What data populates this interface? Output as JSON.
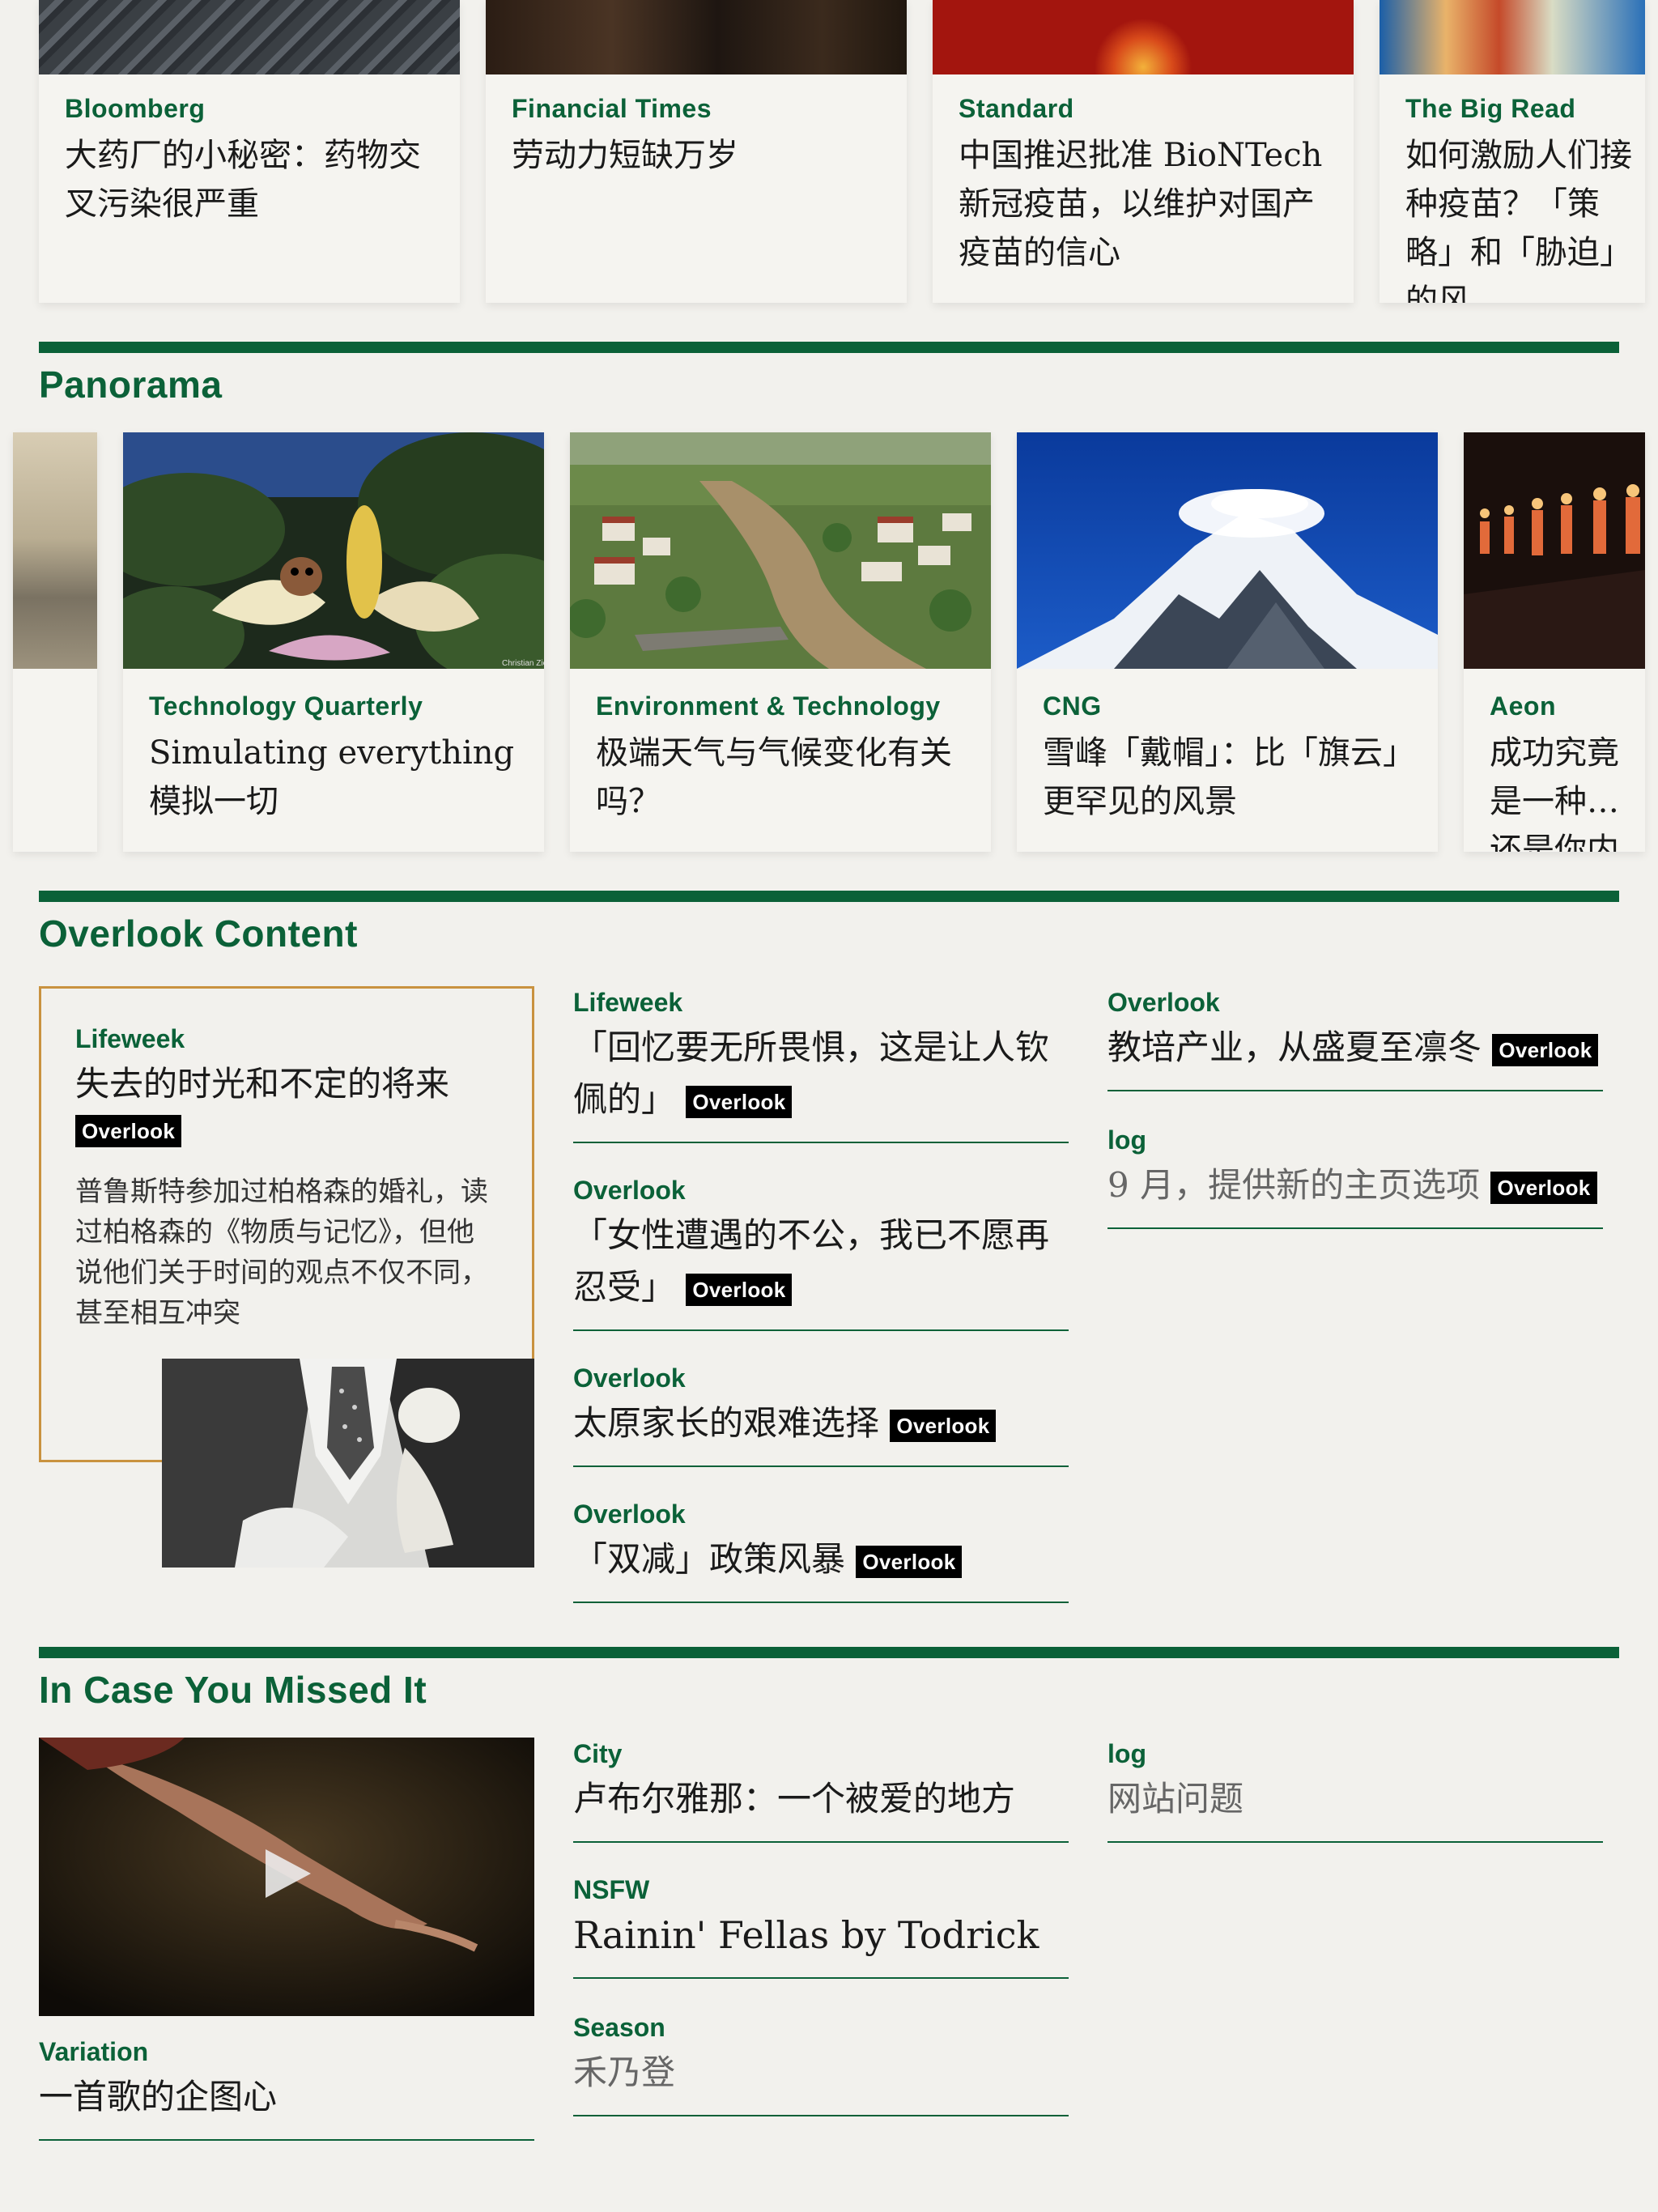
{
  "top_cards": [
    {
      "source": "Bloomberg",
      "title": "大药厂的小秘密：药物交叉污染很严重"
    },
    {
      "source": "Financial Times",
      "title": "劳动力短缺万岁"
    },
    {
      "source": "Standard",
      "title": "中国推迟批准 BioNTech 新冠疫苗，以维护对国产疫苗的信心"
    },
    {
      "source": "The Big Read",
      "title": "如何激励人们接种疫苗？「策略」和「胁迫」的风"
    }
  ],
  "panorama": {
    "heading": "Panorama",
    "cards": [
      {
        "source": "Technology Quarterly",
        "title": "Simulating everything 模拟一切",
        "photo_credit": "Christian Ziegler"
      },
      {
        "source": "Environment & Technology",
        "title": "极端天气与气候变化有关吗？"
      },
      {
        "source": "CNG",
        "title": "雪峰「戴帽」：比「旗云」更罕见的风景"
      },
      {
        "source": "Aeon",
        "title": "成功究竟是一种…还是你内心的…"
      }
    ]
  },
  "overlook": {
    "heading": "Overlook Content",
    "tag_label": "Overlook",
    "featured": {
      "source": "Lifeweek",
      "title": "失去的时光和不定的将来",
      "description": "普鲁斯特参加过柏格森的婚礼，读过柏格森的《物质与记忆》，但他说他们关于时间的观点不仅不同，甚至相互冲突"
    },
    "middle": [
      {
        "source": "Lifeweek",
        "title": "「回忆要无所畏惧，这是让人钦佩的」"
      },
      {
        "source": "Overlook",
        "title": "「女性遭遇的不公，我已不愿再忍受」"
      },
      {
        "source": "Overlook",
        "title": "太原家长的艰难选择"
      },
      {
        "source": "Overlook",
        "title": "「双减」政策风暴"
      }
    ],
    "right": [
      {
        "source": "Overlook",
        "title": "教培产业，从盛夏至凛冬"
      },
      {
        "source": "log",
        "title": "9 月，提供新的主页选项"
      }
    ]
  },
  "missed": {
    "heading": "In Case You Missed It",
    "video_item": {
      "source": "Variation",
      "title": "一首歌的企图心"
    },
    "middle": [
      {
        "source": "City",
        "title": "卢布尔雅那：一个被爱的地方"
      },
      {
        "source": "NSFW",
        "title": "Rainin' Fellas by Todrick"
      },
      {
        "source": "Season",
        "title": "禾乃登"
      }
    ],
    "right": [
      {
        "source": "log",
        "title": "网站问题"
      }
    ]
  },
  "colors": {
    "accent": "#0b6138",
    "feature_border": "#c9923f",
    "background": "#f2f1ed"
  }
}
